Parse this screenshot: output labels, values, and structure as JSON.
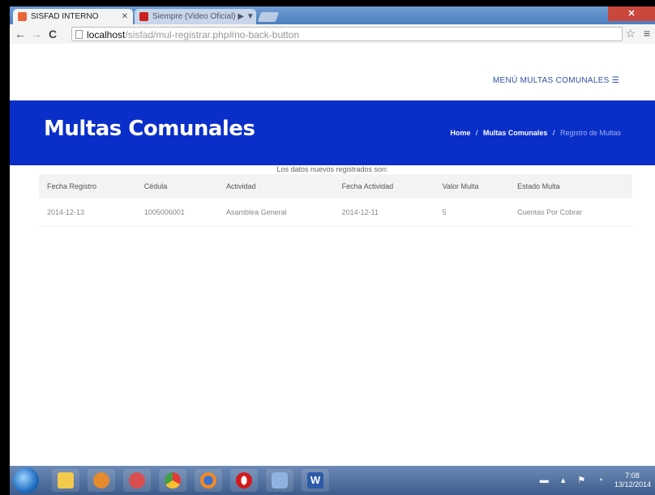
{
  "browser": {
    "tabs": [
      {
        "title": "SISFAD INTERNO",
        "active": true,
        "favicon_color": "#e8663a"
      },
      {
        "title": "Siempre (Video Oficial) ▶ ▼",
        "active": false,
        "favicon_color": "#cc1f1f"
      }
    ],
    "address": {
      "host": "localhost",
      "path": "/sisfad/mul-registrar.php#no-back-button"
    },
    "nav": {
      "back": "←",
      "forward": "→",
      "reload": "C"
    },
    "star_icon": "☆",
    "menu_icon": "≡"
  },
  "header": {
    "menu_label": "MENÚ MULTAS COMUNALES ☰"
  },
  "banner": {
    "title": "Multas Comunales",
    "breadcrumb": {
      "home": "Home",
      "section": "Multas Comunales",
      "current": "Registro de Multas",
      "separator": "/"
    },
    "color": "#0a2ec8"
  },
  "results": {
    "caption": "Los datos nuevos registrados son:",
    "columns": [
      "Fecha Registro",
      "Cédula",
      "Actividad",
      "Fecha Actividad",
      "Valor Multa",
      "Estado Multa"
    ],
    "rows": [
      [
        "2014-12-13",
        "1005006001",
        "Asamblea General",
        "2014-12-11",
        "5",
        "Cuentas Por Cobrar"
      ]
    ]
  },
  "taskbar": {
    "apps": [
      {
        "name": "explorer-icon",
        "color": "#f2c94c"
      },
      {
        "name": "media-player-icon",
        "color": "#e68a2e"
      },
      {
        "name": "paint-icon",
        "color": "#d94f4f"
      },
      {
        "name": "chrome-icon",
        "color": "#4caf50"
      },
      {
        "name": "firefox-icon",
        "color": "#f08a24"
      },
      {
        "name": "opera-icon",
        "color": "#d11a1a"
      },
      {
        "name": "virtualbox-icon",
        "color": "#8fb3e0"
      },
      {
        "name": "word-icon",
        "color": "#2b5aa8"
      }
    ],
    "tray_icons": "▬ ▴ ⚑ ◔",
    "time": "7:08",
    "date": "13/12/2014"
  }
}
